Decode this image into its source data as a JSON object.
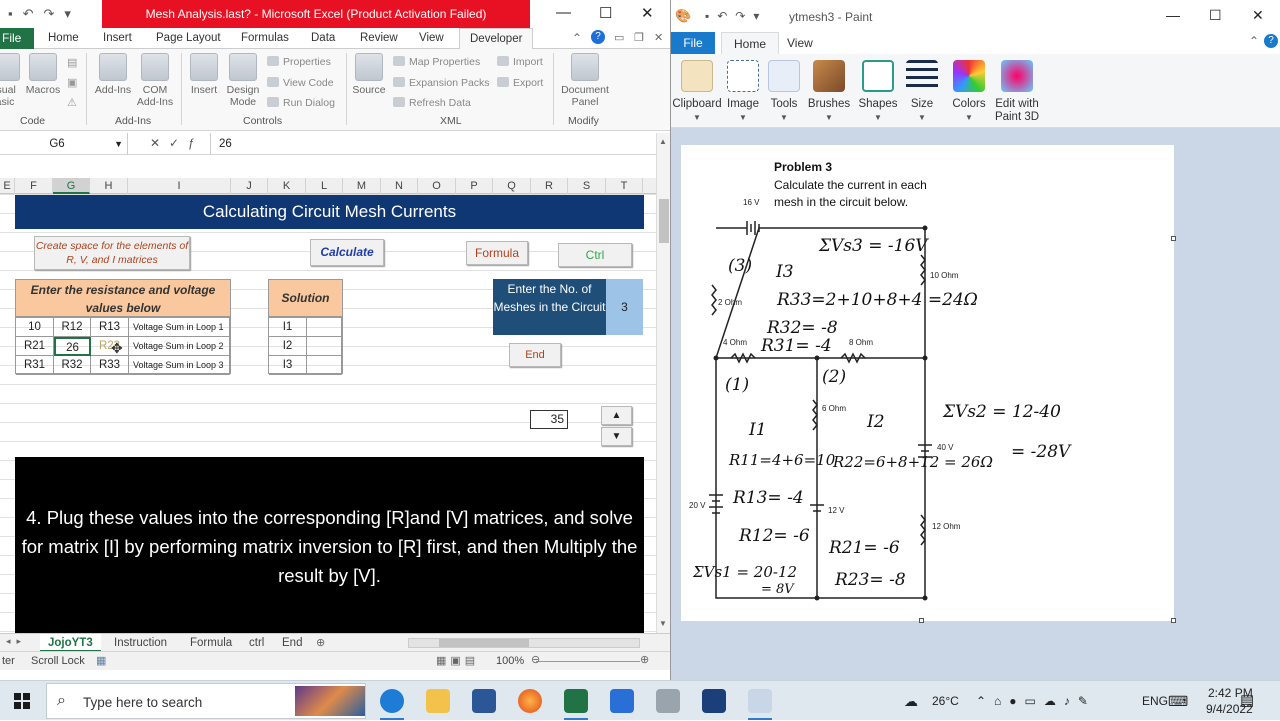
{
  "excel": {
    "title": "Mesh Analysis.last? - Microsoft Excel (Product Activation Failed)",
    "tabs": [
      "File",
      "Home",
      "Insert",
      "Page Layout",
      "Formulas",
      "Data",
      "Review",
      "View",
      "Developer"
    ],
    "ribbon": {
      "code_group": "Code",
      "addins_group": "Add-Ins",
      "controls_group": "Controls",
      "xml_group": "XML",
      "modify_group": "Modify",
      "visual_basic": "isual\nasic",
      "macros": "Macros",
      "addins": "Add-Ins",
      "com_addins": "COM\nAdd-Ins",
      "insert": "Insert",
      "design_mode": "Design\nMode",
      "properties": "Properties",
      "view_code": "View Code",
      "run_dialog": "Run Dialog",
      "source": "Source",
      "map_properties": "Map Properties",
      "expansion_packs": "Expansion Packs",
      "refresh_data": "Refresh Data",
      "import": "Import",
      "export": "Export",
      "document_panel": "Document\nPanel"
    },
    "name_box": "G6",
    "formula_value": "26",
    "columns": [
      "E",
      "F",
      "G",
      "H",
      "I",
      "J",
      "K",
      "L",
      "M",
      "N",
      "O",
      "P",
      "Q",
      "R",
      "S",
      "T"
    ],
    "banner": "Calculating Circuit Mesh Currents",
    "create_space_btn": "Create space for the elements of R, V, and I matrices",
    "calculate_btn": "Calculate",
    "formula_btn": "Formula",
    "ctrl_btn": "Ctrl",
    "input_header": "Enter the resistance and voltage values below",
    "solution_header": "Solution",
    "meshes_prompt": "Enter the No. of Meshes in the Circuit",
    "meshes_value": "3",
    "end_btn": "End",
    "spinner_value": "35",
    "r_table": [
      [
        "10",
        "R12",
        "R13",
        "Voltage Sum in Loop 1"
      ],
      [
        "R21",
        "26",
        "R23",
        "Voltage Sum in Loop 2"
      ],
      [
        "R31",
        "R32",
        "R33",
        "Voltage Sum in Loop 3"
      ]
    ],
    "solution_rows": [
      "I1",
      "I2",
      "I3"
    ],
    "instruction": "4. Plug these values into the corresponding [R]and [V] matrices, and solve for matrix [I] by performing matrix inversion to [R] first, and then Multiply the result by [V].",
    "sheet_tabs": [
      "JojoYT3",
      "Instruction",
      "Formula",
      "ctrl",
      "End"
    ],
    "status_left": "ter",
    "status_scroll": "Scroll Lock",
    "zoom": "100%"
  },
  "paint": {
    "title": "ytmesh3 - Paint",
    "tabs": [
      "File",
      "Home",
      "View"
    ],
    "tools": [
      "Clipboard",
      "Image",
      "Tools",
      "Brushes",
      "Shapes",
      "Size",
      "Colors",
      "Edit with Paint 3D"
    ],
    "problem_title": "Problem 3",
    "problem_text_1": "Calculate the current in each",
    "problem_text_2": "mesh in the circuit below.",
    "labels": {
      "v16": "16 V",
      "r10": "10 Ohm",
      "r2": "2 Ohm",
      "r4": "4 Ohm",
      "r8": "8 Ohm",
      "r6": "6 Ohm",
      "v40": "40 V",
      "v20": "20 V",
      "v12": "12 V",
      "r12": "12 Ohm"
    },
    "handwriting": {
      "loop3": "(3)",
      "i3": "I3",
      "sum3": "ΣVs3 = -16V",
      "r33": "R33=2+10+8+4 =24Ω",
      "r32": "R32= -8",
      "r31": "R31= -4",
      "loop1": "(1)",
      "loop2": "(2)",
      "i1": "I1",
      "i2": "I2",
      "sum2a": "ΣVs2 = 12-40",
      "sum2b": "= -28V",
      "r11": "R11=4+6=10",
      "r22": "R22=6+8+12 = 26Ω",
      "r13": "R13= -4",
      "r12h": "R12= -6",
      "r21": "R21= -6",
      "r23": "R23= -8",
      "sum1a": "ΣVs1 = 20-12",
      "sum1b": "= 8V"
    }
  },
  "taskbar": {
    "search_placeholder": "Type here to search",
    "temperature": "26°C",
    "lang": "ENG",
    "time": "2:42 PM",
    "date": "9/4/2022"
  },
  "colors": {
    "excel_green": "#217346",
    "banner_blue": "#0f3774",
    "header_orange": "#f9c89e",
    "meshes_blue": "#1f4e79",
    "paint_blue": "#1979ca"
  }
}
